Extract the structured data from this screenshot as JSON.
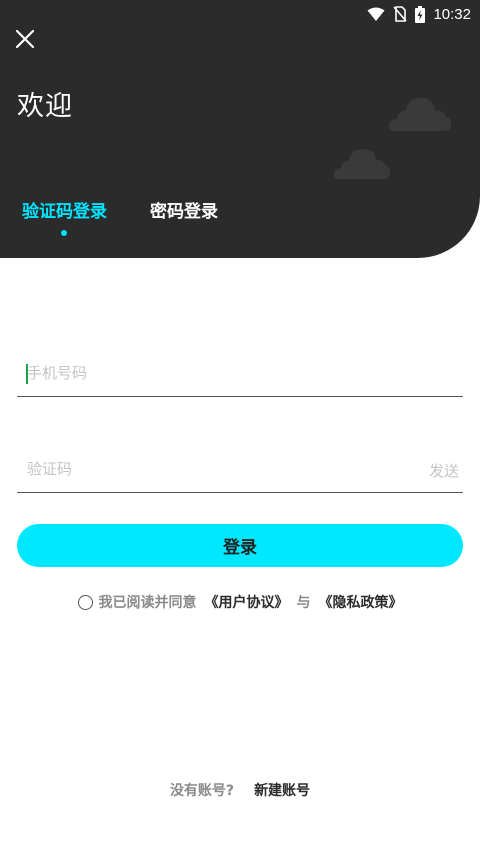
{
  "status_bar": {
    "time": "10:32",
    "icons": [
      "wifi-icon",
      "no-sim-icon",
      "battery-charging-icon"
    ]
  },
  "header": {
    "close_icon": "close-icon",
    "welcome": "欢迎"
  },
  "tabs": [
    {
      "label": "验证码登录",
      "active": true
    },
    {
      "label": "密码登录",
      "active": false
    }
  ],
  "form": {
    "phone": {
      "placeholder": "手机号码",
      "value": ""
    },
    "code": {
      "placeholder": "验证码",
      "value": "",
      "send_label": "发送"
    },
    "login_label": "登录"
  },
  "agreement": {
    "prefix": "我已阅读并同意",
    "user_agreement": "《用户协议》",
    "connector": "与",
    "privacy_policy": "《隐私政策》",
    "checked": false
  },
  "register": {
    "question": "没有账号?",
    "link": "新建账号"
  },
  "colors": {
    "header_bg": "#2b2b2b",
    "accent": "#00e5ff",
    "button": "#00e8ff"
  }
}
